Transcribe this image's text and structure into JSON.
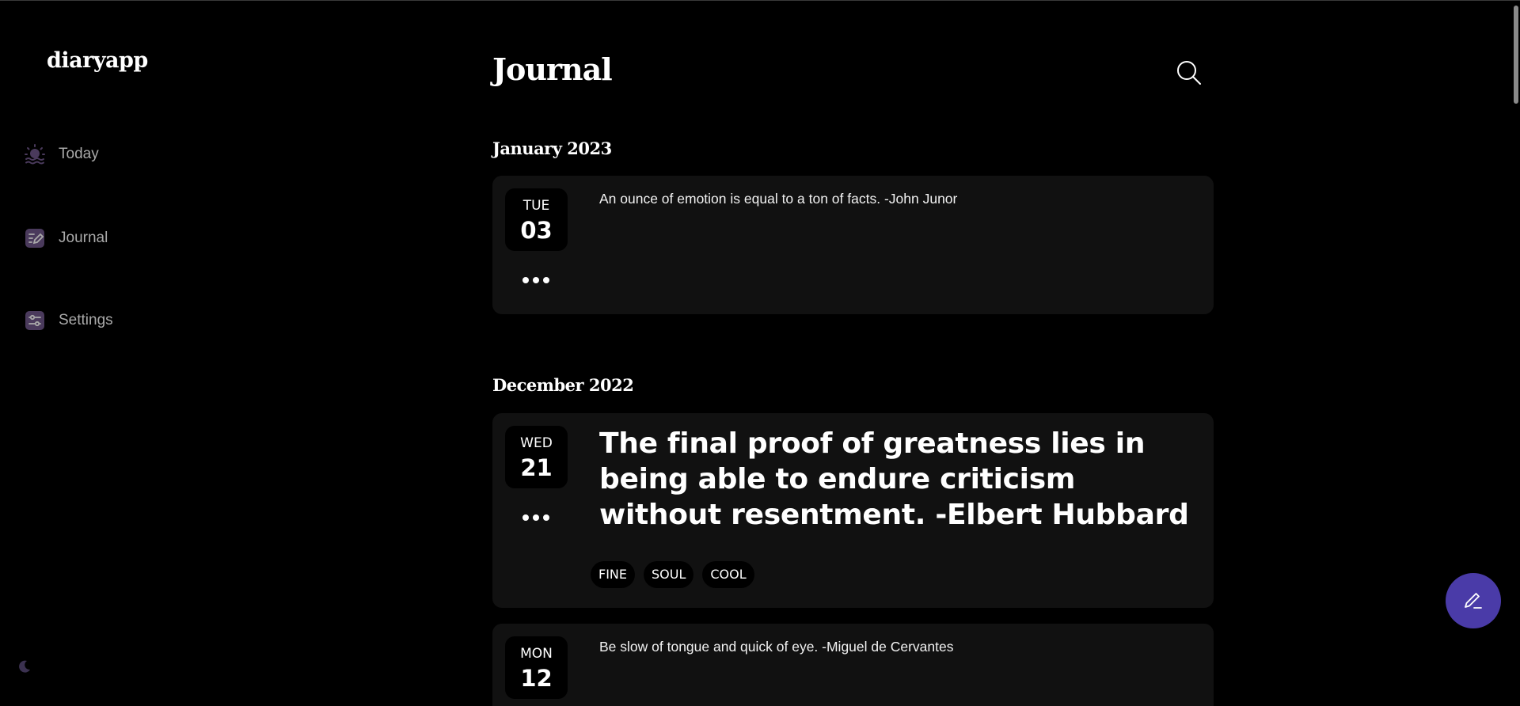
{
  "app": {
    "brand": "diaryapp"
  },
  "sidebar": {
    "items": [
      {
        "label": "Today",
        "icon": "sunrise-icon"
      },
      {
        "label": "Journal",
        "icon": "edit-note-icon"
      },
      {
        "label": "Settings",
        "icon": "sliders-icon"
      }
    ],
    "theme_toggle_icon": "moon-icon"
  },
  "header": {
    "title": "Journal",
    "search_icon": "search-icon"
  },
  "months": [
    {
      "label": "January 2023",
      "entries": [
        {
          "dow": "TUE",
          "day": "03",
          "text": "An ounce of emotion is equal to a ton of facts. -John Junor",
          "tags": []
        }
      ]
    },
    {
      "label": "December 2022",
      "entries": [
        {
          "dow": "WED",
          "day": "21",
          "text": "The final proof of greatness lies in being able to endure criticism without resentment. -Elbert Hubbard",
          "tags": [
            "FINE",
            "SOUL",
            "COOL"
          ]
        },
        {
          "dow": "MON",
          "day": "12",
          "text": "Be slow of tongue and quick of eye. -Miguel de Cervantes",
          "tags": []
        }
      ]
    }
  ],
  "fab": {
    "icon": "pencil-icon"
  },
  "colors": {
    "background": "#000000",
    "card": "#111111",
    "accent": "#4a3ba8",
    "nav_icon": "#4a3a5c",
    "nav_text": "#a9a9a9"
  }
}
